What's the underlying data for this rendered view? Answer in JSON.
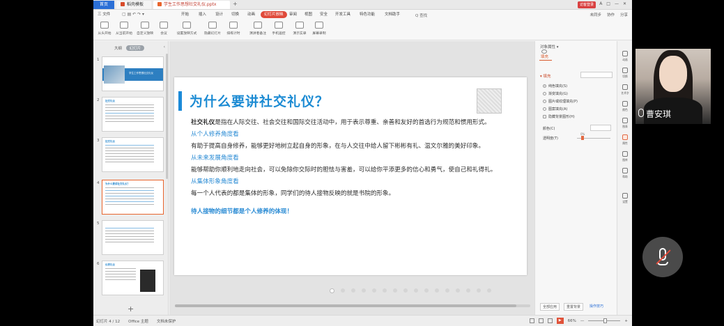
{
  "window": {
    "tabs": [
      "首页",
      "稻壳模板",
      "学生工作思想社交礼仪.pptx"
    ],
    "right": [
      "A",
      "□",
      "—",
      "✕"
    ],
    "login": "访客登录"
  },
  "menubar": {
    "items": [
      "三 文件",
      "开始",
      "插入",
      "设计",
      "切换",
      "动画",
      "幻灯片放映",
      "审阅",
      "视图",
      "安全",
      "开发工具",
      "特色功能",
      "文档助手"
    ],
    "active_index": 6,
    "search": "Q 查找",
    "right": [
      "未同步",
      "协作",
      "分享"
    ]
  },
  "ribbon": {
    "buttons": [
      "从头开始",
      "从当前开始",
      "自定义放映",
      "会议",
      "设置放映方式",
      "隐藏幻灯片",
      "排练计时",
      "演讲者备注",
      "手机遥控",
      "演示实录",
      "屏幕录制"
    ]
  },
  "leftpanel": {
    "tab_outline": "大纲",
    "tab_slides": "幻灯片",
    "slides": [
      {
        "num": "1",
        "title": "学生工作思想社交礼仪"
      },
      {
        "num": "2",
        "title": "社交礼仪"
      },
      {
        "num": "3",
        "title": "社交礼仪"
      },
      {
        "num": "4",
        "title": "为什么要讲社交礼仪？"
      },
      {
        "num": "5",
        "title": ""
      },
      {
        "num": "6",
        "title": "仪表礼仪"
      }
    ],
    "add_slide": "+"
  },
  "slide": {
    "title": "为什么要讲社交礼仪？",
    "p1_bold": "社交礼仪",
    "p1_rest": "是指在人际交往、社会交往和国际交往活动中，用于表示尊重、亲善和友好的首选行为规范和惯用形式。",
    "h1": "从个人修养角度看",
    "p2": "有助于提高自身修养，能够更好地树立起自身的形象，在与人交往中给人留下彬彬有礼、温文尔雅的美好印象。",
    "h2": "从未来发展角度看",
    "p3": "能够帮助你顺利地走向社会，可以免除你交际时的胆怯与害羞，可以给你平添更多的信心和勇气，使自己和礼得礼。",
    "h3": "从集体形象角度看",
    "p4": "每一个人代表的都是集体的形象，同学们的待人接物反映的就是书院的形象。",
    "emphasis": "待人接物的细节都是个人修养的体现！"
  },
  "pager": {
    "count": 16,
    "active": 0
  },
  "rightpanel": {
    "title": "对象属性 ▾",
    "tab": "填充",
    "section": "▾ 填充",
    "options": [
      "纯色填充(S)",
      "渐变填充(G)",
      "图片或纹理填充(P)",
      "图案填充(A)",
      "隐藏背景图形(H)"
    ],
    "selected": 0,
    "color_label": "颜色(C)",
    "transparency_label": "透明度(T)",
    "transparency_value": "0%",
    "bottom": [
      "全部应用",
      "重置背景",
      "操作技巧"
    ]
  },
  "iconcol": {
    "items": [
      "动画",
      "切换",
      "艺术字",
      "颜色",
      "图表",
      "属性",
      "图库",
      "帮助",
      "设置"
    ],
    "active": 5
  },
  "statusbar": {
    "slide_info": "幻灯片 4 / 12",
    "theme": "Office 主题",
    "protect": "文档未保护",
    "zoom": "66%",
    "minus": "—",
    "plus": "+"
  },
  "meeting": {
    "participant": "曹安琪"
  }
}
